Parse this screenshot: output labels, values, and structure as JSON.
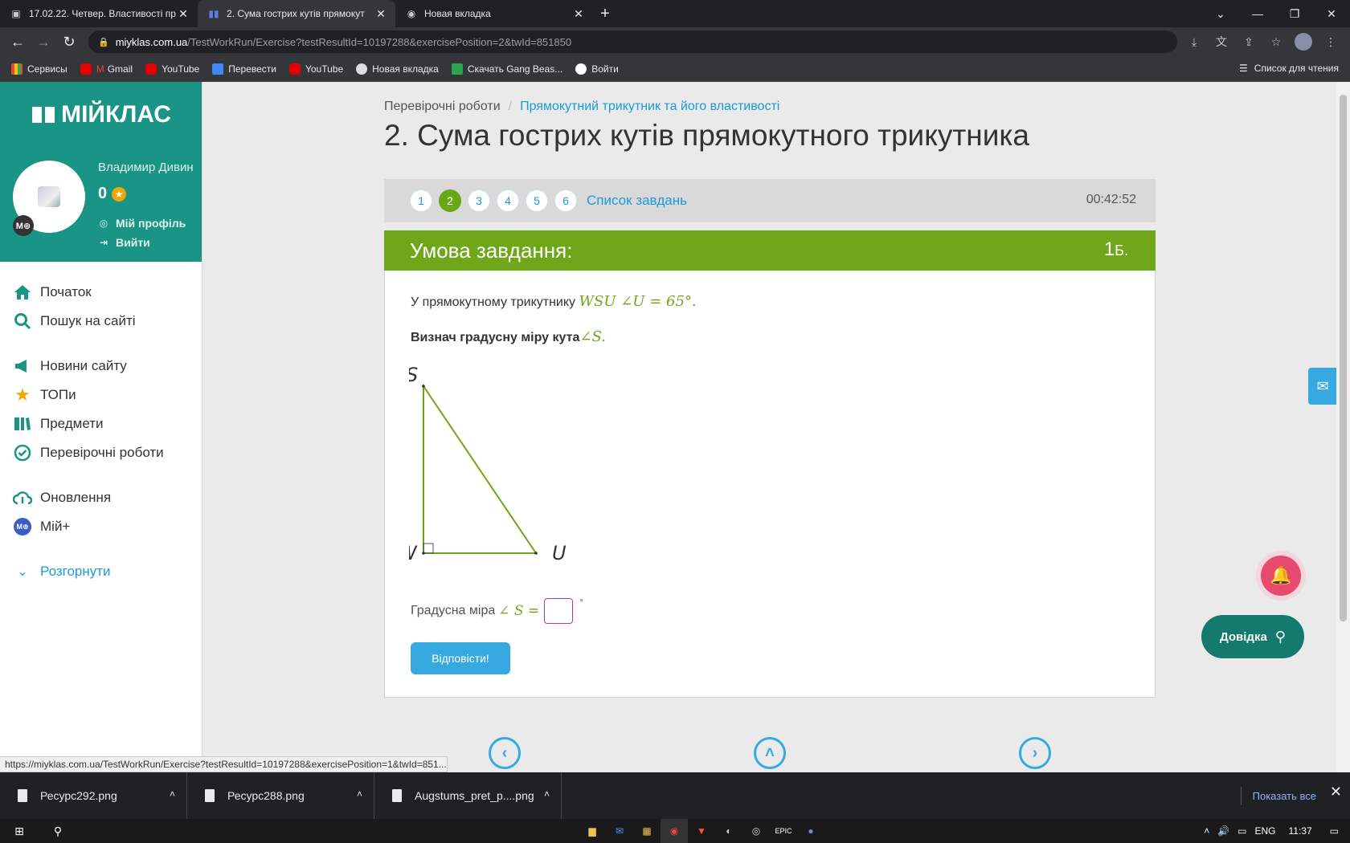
{
  "browser": {
    "tabs": [
      {
        "title": "17.02.22. Четвер. Властивості пр",
        "active": false
      },
      {
        "title": "2. Сума гострих кутів прямокут",
        "active": true
      },
      {
        "title": "Новая вкладка",
        "active": false
      }
    ],
    "url_host": "miyklas.com.ua",
    "url_path": "/TestWorkRun/Exercise?testResultId=10197288&exercisePosition=2&twId=851850",
    "bookmarks": [
      "Сервисы",
      "Gmail",
      "YouTube",
      "Перевести",
      "YouTube",
      "Новая вкладка",
      "Скачать Gang Beas...",
      "Войти"
    ],
    "reading_list": "Список для чтения",
    "status_url": "https://miyklas.com.ua/TestWorkRun/Exercise?testResultId=10197288&exercisePosition=1&twId=851..."
  },
  "sidebar": {
    "logo": "МІЙКЛАС",
    "user_name": "Владимир Дивин",
    "points": "0",
    "badge": "М⊕",
    "profile_link": "Мій профіль",
    "logout_link": "Вийти",
    "menu": [
      "Початок",
      "Пошук на сайті",
      "Новини сайту",
      "ТОПи",
      "Предмети",
      "Перевірочні роботи",
      "Оновлення",
      "Мій+"
    ],
    "expand": "Розгорнути"
  },
  "main": {
    "breadcrumb_root": "Перевірочні роботи",
    "breadcrumb_sep": "/",
    "breadcrumb_current": "Прямокутний трикутник та його властивості",
    "title": "2. Сума гострих кутів прямокутного трикутника",
    "pages": [
      "1",
      "2",
      "3",
      "4",
      "5",
      "6"
    ],
    "active_page": "2",
    "task_list": "Список завдань",
    "timer": "00:42:52",
    "condition_title": "Умова завдання:",
    "score_num": "1",
    "score_unit": "Б.",
    "text1": "У прямокутному трикутнику ",
    "math1": "WSU ∠U = 65°.",
    "text2": "Визнач градусну міру кута",
    "math2": "∠S.",
    "vertices": {
      "s": "S",
      "w": "W",
      "u": "U"
    },
    "answer_label": "Градусна міра ",
    "answer_math": "∠ S =",
    "answer_unit": "°",
    "submit": "Відповісти!",
    "help": "Довідка"
  },
  "downloads": {
    "files": [
      "Ресурс292.png",
      "Ресурс288.png",
      "Augstums_pret_p....png"
    ],
    "show_all": "Показать все"
  },
  "taskbar": {
    "lang": "ENG",
    "time": "11:37"
  }
}
